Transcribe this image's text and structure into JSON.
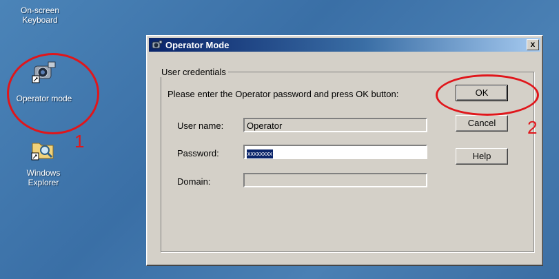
{
  "desktop": {
    "icons": [
      {
        "label": "On-screen\nKeyboard",
        "line1": "On-screen",
        "line2": "Keyboard"
      },
      {
        "label": "Operator mode"
      },
      {
        "line1": "Windows",
        "line2": "Explorer"
      }
    ]
  },
  "annotations": {
    "step1": "1",
    "step2": "2",
    "color": "#e0161b"
  },
  "dialog": {
    "title": "Operator Mode",
    "close_label": "x",
    "group_label": "User credentials",
    "instruction": "Please enter the Operator password and press OK button:",
    "fields": {
      "username_label": "User name:",
      "username_value": "Operator",
      "password_label": "Password:",
      "password_value": "xxxxxxxx",
      "domain_label": "Domain:",
      "domain_value": ""
    },
    "buttons": {
      "ok": "OK",
      "cancel": "Cancel",
      "help": "Help"
    }
  }
}
